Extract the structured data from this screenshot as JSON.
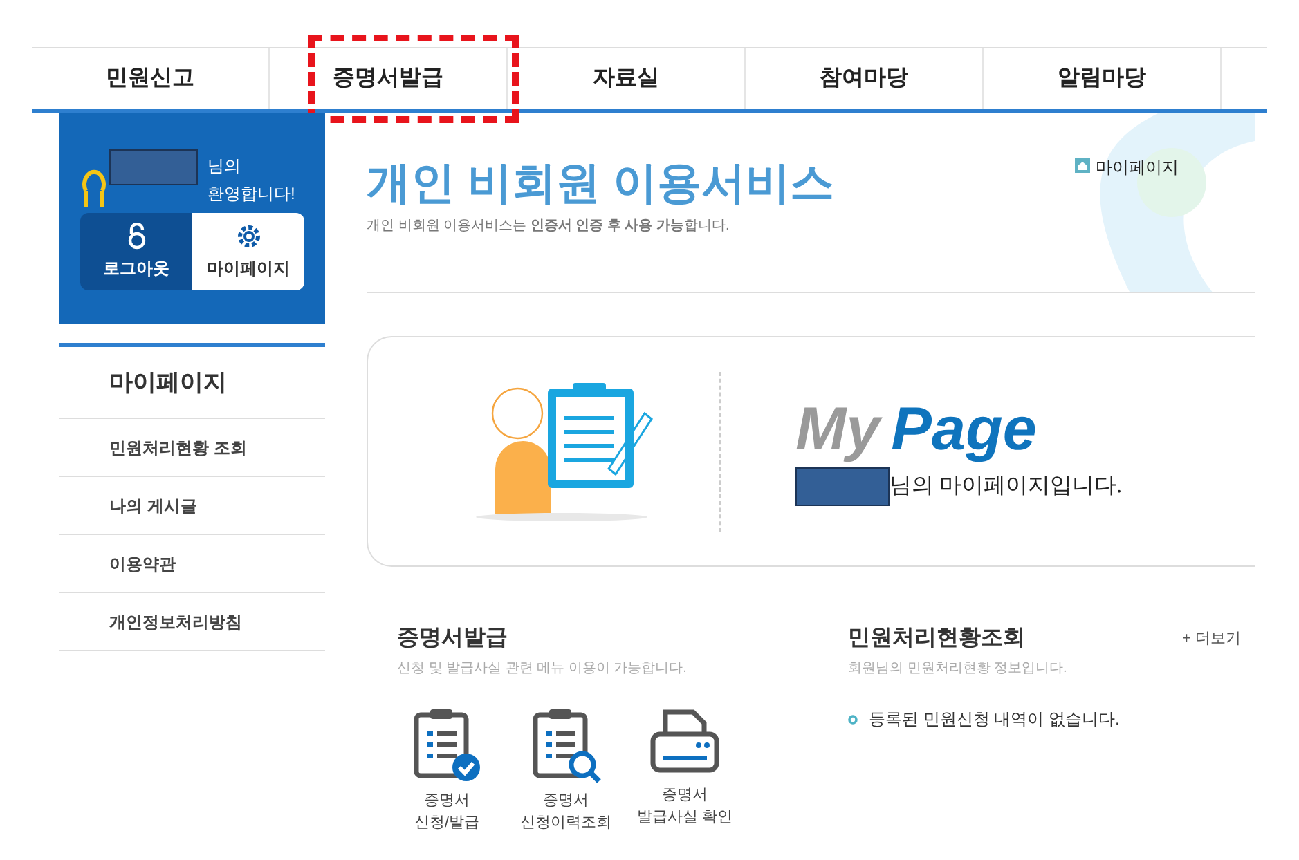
{
  "nav": [
    {
      "label": "민원신고",
      "highlighted": false
    },
    {
      "label": "증명서발급",
      "highlighted": true
    },
    {
      "label": "자료실",
      "highlighted": false
    },
    {
      "label": "참여마당",
      "highlighted": false
    },
    {
      "label": "알림마당",
      "highlighted": false
    }
  ],
  "user_panel": {
    "greeting_line_1": "님의",
    "greeting_line_2": "환영합니다!",
    "buttons": [
      {
        "label": "로그아웃",
        "kind": "logout"
      },
      {
        "label": "마이페이지",
        "kind": "mypage"
      }
    ]
  },
  "sidebar": {
    "title": "마이페이지",
    "items": [
      {
        "label": "민원처리현황 조회"
      },
      {
        "label": "나의 게시글"
      },
      {
        "label": "이용약관"
      },
      {
        "label": "개인정보처리방침"
      }
    ]
  },
  "header": {
    "title": "개인 비회원 이용서비스",
    "subtitle": "개인 비회원 이용서비스는 **인증서 인증 후 사용 가능**합니다.",
    "breadcrumb": "마이페이지"
  },
  "mypage_card": {
    "logo_1": "My",
    "logo_2": "Page",
    "message": "님의 마이페이지입니다."
  },
  "certificate": {
    "title": "증명서발급",
    "subtitle": "신청 및 발급사실 관련 메뉴 이용이 가능합니다.",
    "actions": [
      {
        "kind": "apply",
        "line_1": "증명서",
        "line_2": "신청/발급"
      },
      {
        "kind": "history",
        "line_1": "증명서",
        "line_2": "신청이력조회"
      },
      {
        "kind": "verify",
        "line_1": "증명서",
        "line_2": "발급사실 확인"
      }
    ]
  },
  "status": {
    "title": "민원처리현황조회",
    "more": "+ 더보기",
    "subtitle": "회원님의 민원처리현황 정보입니다.",
    "empty_message": "등록된 민원신청 내역이 없습니다."
  }
}
